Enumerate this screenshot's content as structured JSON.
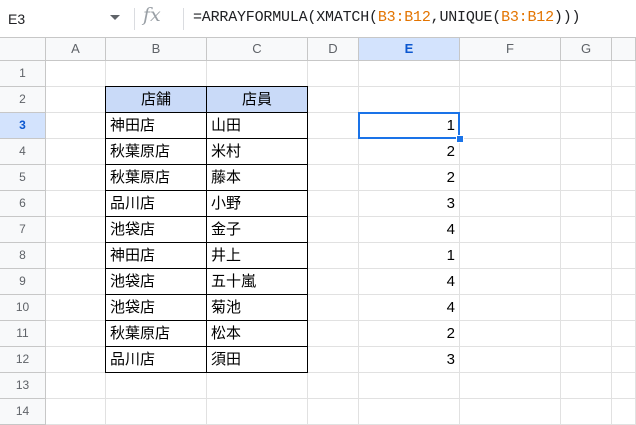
{
  "formula_bar": {
    "cell_ref": "E3",
    "fx_label": "fx",
    "formula_parts": [
      "=ARRAYFORMULA(XMATCH(",
      "B3:B12",
      ",UNIQUE(",
      "B3:B12",
      ")))"
    ]
  },
  "columns": [
    "A",
    "B",
    "C",
    "D",
    "E",
    "F",
    "G"
  ],
  "rows": [
    "1",
    "2",
    "3",
    "4",
    "5",
    "6",
    "7",
    "8",
    "9",
    "10",
    "11",
    "12",
    "13",
    "14"
  ],
  "table": {
    "headers": [
      "店舗",
      "店員"
    ],
    "rows": [
      [
        "神田店",
        "山田"
      ],
      [
        "秋葉原店",
        "米村"
      ],
      [
        "秋葉原店",
        "藤本"
      ],
      [
        "品川店",
        "小野"
      ],
      [
        "池袋店",
        "金子"
      ],
      [
        "神田店",
        "井上"
      ],
      [
        "池袋店",
        "五十嵐"
      ],
      [
        "池袋店",
        "菊池"
      ],
      [
        "秋葉原店",
        "松本"
      ],
      [
        "品川店",
        "須田"
      ]
    ]
  },
  "results": [
    "1",
    "2",
    "2",
    "3",
    "4",
    "1",
    "4",
    "4",
    "2",
    "3"
  ],
  "colors": {
    "header_fill": "#c9daf8",
    "selection": "#1a73e8",
    "formula_ref": "#e37400"
  }
}
